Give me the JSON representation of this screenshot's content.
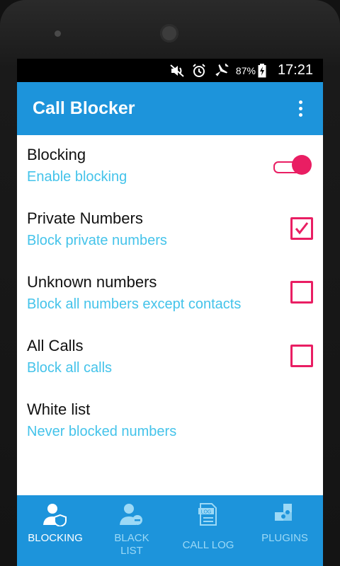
{
  "status_bar": {
    "battery_percent": "87%",
    "time": "17:21",
    "icons": [
      "mute-icon",
      "alarm-icon",
      "airplane-icon",
      "battery-charging-icon"
    ]
  },
  "app_bar": {
    "title": "Call Blocker"
  },
  "settings": [
    {
      "title": "Blocking",
      "subtitle": "Enable blocking",
      "control": "toggle",
      "on": true
    },
    {
      "title": "Private Numbers",
      "subtitle": "Block private numbers",
      "control": "checkbox",
      "checked": true
    },
    {
      "title": "Unknown numbers",
      "subtitle": "Block all numbers except contacts",
      "control": "checkbox",
      "checked": false
    },
    {
      "title": "All Calls",
      "subtitle": "Block all calls",
      "control": "checkbox",
      "checked": false
    },
    {
      "title": "White list",
      "subtitle": "Never blocked numbers",
      "control": "none"
    }
  ],
  "bottom_nav": [
    {
      "label": "BLOCKING",
      "active": true,
      "icon": "blocking-shield-user-icon"
    },
    {
      "label": "BLACK LIST",
      "active": false,
      "icon": "blacklist-user-block-icon"
    },
    {
      "label": "CALL LOG",
      "active": false,
      "icon": "call-log-document-icon"
    },
    {
      "label": "PLUGINS",
      "active": false,
      "icon": "plugins-puzzle-icon"
    }
  ],
  "colors": {
    "primary": "#1D94DB",
    "accent": "#E91E63",
    "subtitle": "#44C3EA"
  }
}
